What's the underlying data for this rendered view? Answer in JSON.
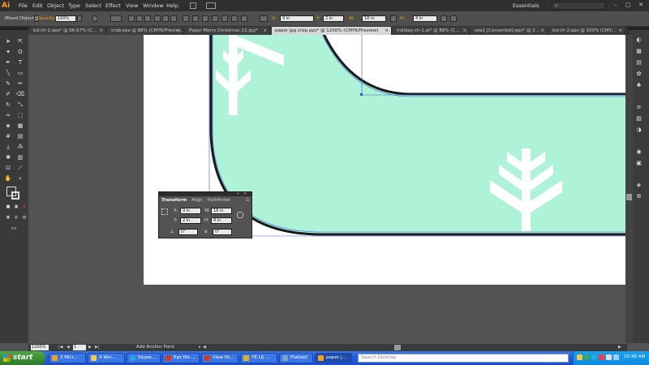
{
  "app": {
    "logo": "Ai",
    "menus": [
      "File",
      "Edit",
      "Object",
      "Type",
      "Select",
      "Effect",
      "View",
      "Window",
      "Help"
    ],
    "workspace": "Essentials",
    "window_controls": [
      "–",
      "□",
      "✕"
    ]
  },
  "control_bar": {
    "selection_label": "Mixed Objects",
    "opacity_label": "Opacity:",
    "opacity_value": "100%",
    "x_label": "X:",
    "x_value": "9 in",
    "y_label": "Y:",
    "y_value": "2 in",
    "w_label": "W:",
    "w_value": "18 in",
    "h_label": "H:",
    "h_value": "4 in"
  },
  "tabs": [
    {
      "label": "bd-ch-2.eps* @ 66.67% (C..."
    },
    {
      "label": "crab.eps @ 88% (CMYK/Previe..."
    },
    {
      "label": "Paper Merry Christmas-11.jpg*"
    },
    {
      "label": "paper jpg crop.eps* @ 1200% (CMYK/Preview)",
      "active": true
    },
    {
      "label": "holiday-ch-1.ai* @ 88% (C..."
    },
    {
      "label": "sea1 [Converted].eps* @ 2..."
    },
    {
      "label": "bd-ch-2.eps @ 100% (CMY..."
    }
  ],
  "transform_panel": {
    "tabs": [
      "Transform",
      "Align",
      "Pathfinder"
    ],
    "x_label": "X:",
    "x_value": "9 in",
    "y_label": "Y:",
    "y_value": "2 in",
    "w_label": "W:",
    "w_value": "18 in",
    "h_label": "H:",
    "h_value": "4 in",
    "rotate_value": "0°",
    "shear_value": "0°"
  },
  "status_bar": {
    "zoom": "1200%",
    "page": "1",
    "tool": "Add Anchor Point"
  },
  "taskbar": {
    "start_label": "start",
    "items": [
      {
        "label": "3 Micr...",
        "color": "#e8a030"
      },
      {
        "label": "4 Win...",
        "color": "#f3c84a"
      },
      {
        "label": "Skype...",
        "color": "#29a8e0"
      },
      {
        "label": "Eps file ...",
        "color": "#d04020"
      },
      {
        "label": "View Po...",
        "color": "#d04020"
      },
      {
        "label": "YE LIJ ...",
        "color": "#e0b030"
      },
      {
        "label": "Flatbed",
        "color": "#7aa0d0"
      },
      {
        "label": "paper j...",
        "color": "#f7a21b",
        "active": true
      }
    ],
    "search_placeholder": "Search Desktop",
    "clock": "10:48 AM"
  },
  "colors": {
    "artwork_fill": "#aef2d8",
    "artwork_stroke": "#1a1a1a",
    "path_highlight": "#3b5bd6",
    "snowflake": "#ffffff"
  }
}
